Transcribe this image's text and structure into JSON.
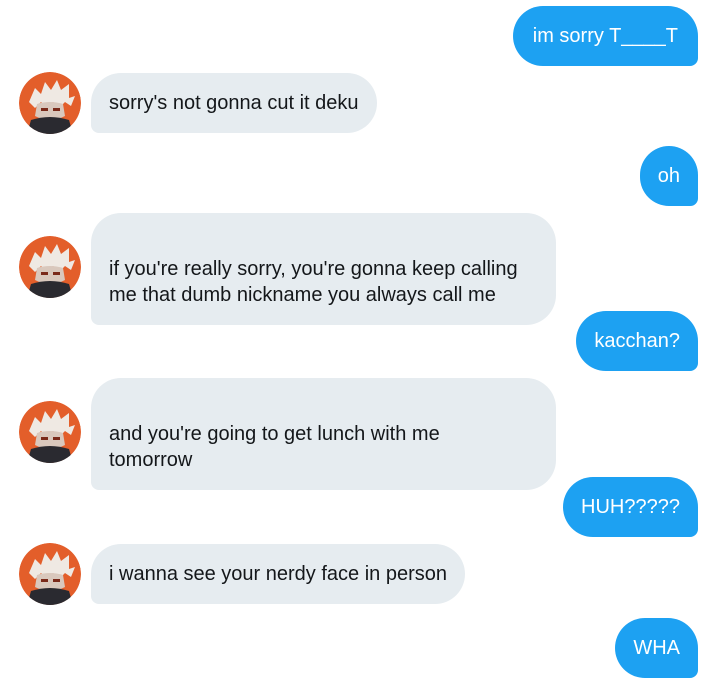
{
  "conversation": {
    "contact": {
      "avatar_icon": "anime-character-avatar-icon",
      "avatar_background_color": "#e35e2a"
    },
    "colors": {
      "sent_bubble": "#1da1f2",
      "received_bubble": "#e6ecf0"
    },
    "messages": [
      {
        "direction": "sent",
        "text": "im sorry T____T"
      },
      {
        "direction": "received",
        "text": "sorry's not gonna cut it deku"
      },
      {
        "direction": "sent",
        "text": "oh"
      },
      {
        "direction": "received",
        "text": "if you're really sorry, you're gonna keep calling\nme that dumb nickname you always call me"
      },
      {
        "direction": "sent",
        "text": "kacchan?"
      },
      {
        "direction": "received",
        "text": "and you're going to get lunch with me\ntomorrow"
      },
      {
        "direction": "sent",
        "text": "HUH?????"
      },
      {
        "direction": "received",
        "text": "i wanna see your nerdy face in person"
      },
      {
        "direction": "sent",
        "text": "WHA"
      }
    ]
  }
}
